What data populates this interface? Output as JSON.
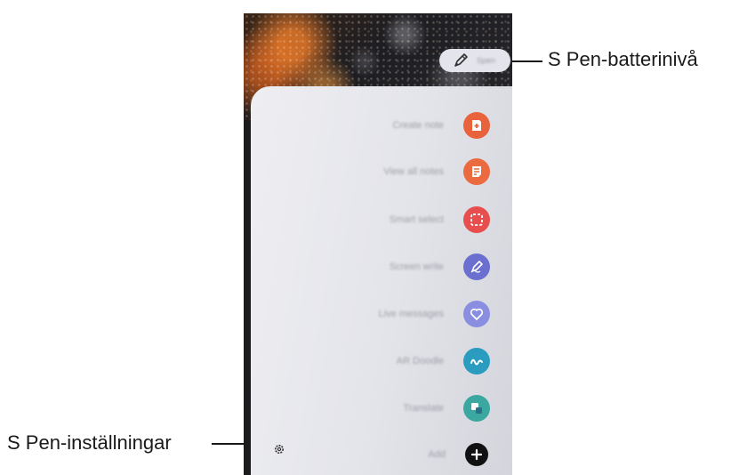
{
  "callouts": {
    "battery": "S Pen-batterinivå",
    "settings": "S Pen-inställningar"
  },
  "battery_pill": {
    "icon": "s-pen-icon",
    "text": "Spen"
  },
  "menu": {
    "items": [
      {
        "label": "Create note",
        "icon": "create-note-icon",
        "color": "#e8623c"
      },
      {
        "label": "View all notes",
        "icon": "notes-list-icon",
        "color": "#ec6a3f"
      },
      {
        "label": "Smart select",
        "icon": "smart-select-icon",
        "color": "#e94e4e"
      },
      {
        "label": "Screen write",
        "icon": "screen-write-icon",
        "color": "#6a6fd0"
      },
      {
        "label": "Live messages",
        "icon": "heart-message-icon",
        "color": "#8a8ee0"
      },
      {
        "label": "AR Doodle",
        "icon": "ar-doodle-icon",
        "color": "#2a9cc0"
      },
      {
        "label": "Translate",
        "icon": "translate-icon",
        "color": "#3aa7a0"
      },
      {
        "label": "Add",
        "icon": "add-icon",
        "color": "#111111"
      }
    ]
  },
  "settings": {
    "icon": "gear-icon"
  }
}
